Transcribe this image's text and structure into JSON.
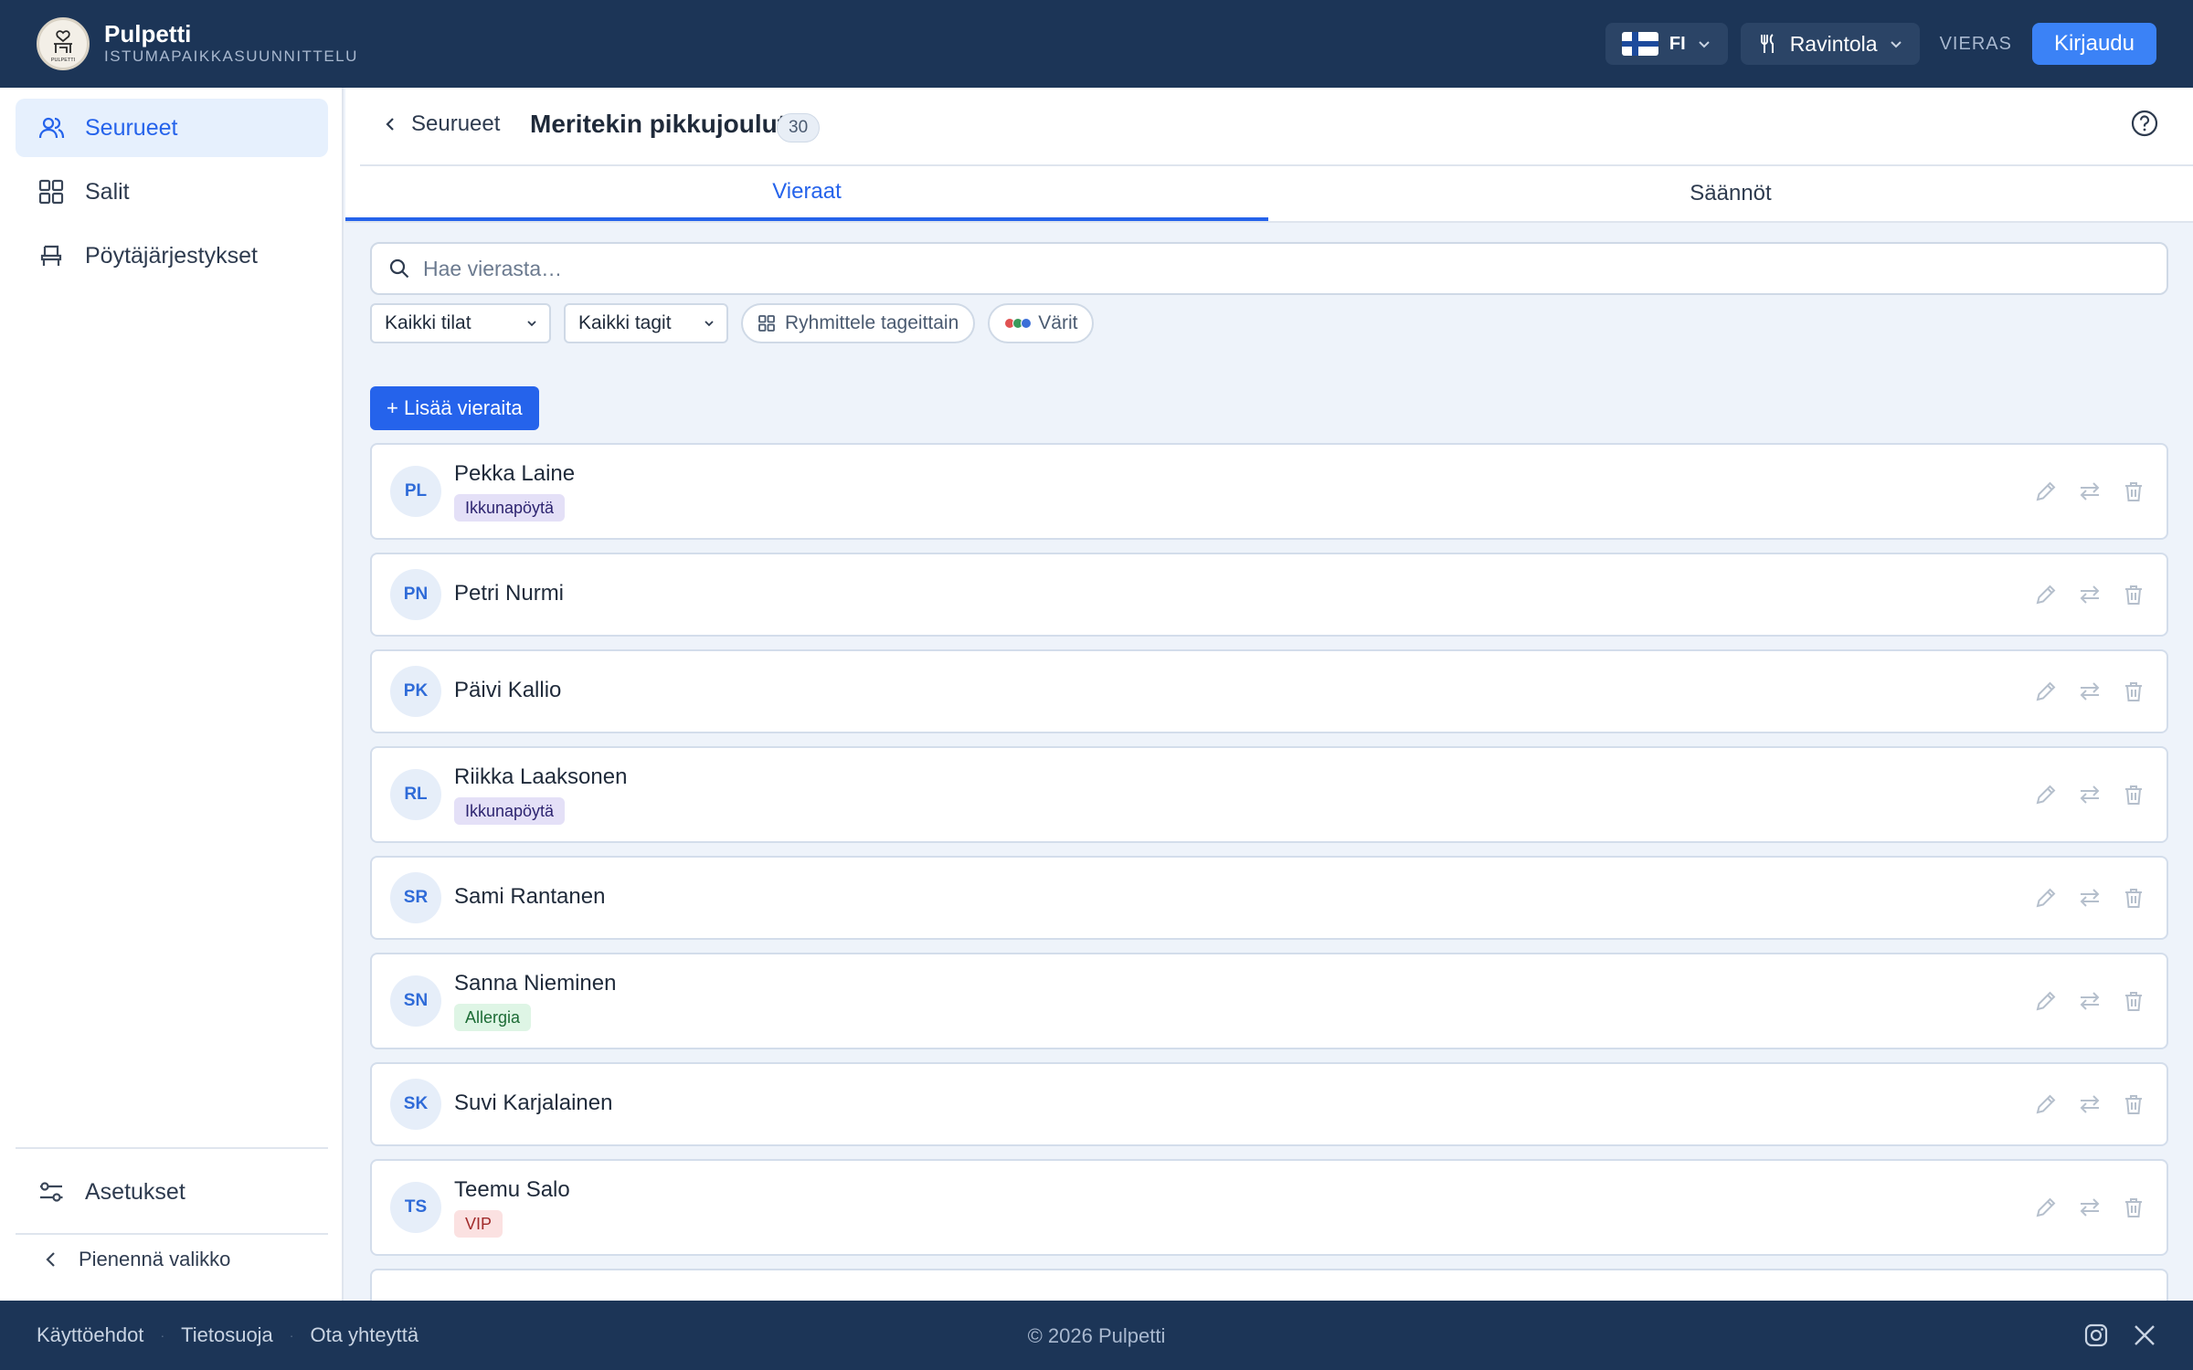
{
  "app": {
    "name": "Pulpetti",
    "subtitle": "ISTUMAPAIKKASUUNNITTELU",
    "logo_text": "PULPETTI"
  },
  "topbar": {
    "language": "FI",
    "venue_type": "Ravintola",
    "guest_label": "VIERAS",
    "login_label": "Kirjaudu"
  },
  "sidebar": {
    "items": [
      {
        "label": "Seurueet",
        "icon": "users-icon",
        "active": true
      },
      {
        "label": "Salit",
        "icon": "grid-icon",
        "active": false
      },
      {
        "label": "Pöytäjärjestykset",
        "icon": "chair-icon",
        "active": false
      }
    ],
    "settings_label": "Asetukset",
    "collapse_label": "Pienennä valikko"
  },
  "header": {
    "back_label": "Seurueet",
    "title": "Meritekin pikkujoulut",
    "count": "30"
  },
  "tabs": [
    {
      "label": "Vieraat",
      "active": true
    },
    {
      "label": "Säännöt",
      "active": false
    }
  ],
  "search": {
    "placeholder": "Hae vierasta…",
    "value": ""
  },
  "filters": {
    "status_select": "Kaikki tilat",
    "tag_select": "Kaikki tagit",
    "group_by_tags": "Ryhmittele tageittain",
    "colors": "Värit",
    "color_dots": [
      "#e05252",
      "#3a9a5b",
      "#3b6fd8"
    ]
  },
  "add_guests_label": "+ Lisää vieraita",
  "guests": [
    {
      "initials": "PL",
      "name": "Pekka Laine",
      "tag": "Ikkunapöytä",
      "tag_type": "purple"
    },
    {
      "initials": "PN",
      "name": "Petri Nurmi",
      "tag": "",
      "tag_type": ""
    },
    {
      "initials": "PK",
      "name": "Päivi Kallio",
      "tag": "",
      "tag_type": ""
    },
    {
      "initials": "RL",
      "name": "Riikka Laaksonen",
      "tag": "Ikkunapöytä",
      "tag_type": "purple"
    },
    {
      "initials": "SR",
      "name": "Sami Rantanen",
      "tag": "",
      "tag_type": ""
    },
    {
      "initials": "SN",
      "name": "Sanna Nieminen",
      "tag": "Allergia",
      "tag_type": "green"
    },
    {
      "initials": "SK",
      "name": "Suvi Karjalainen",
      "tag": "",
      "tag_type": ""
    },
    {
      "initials": "TS",
      "name": "Teemu Salo",
      "tag": "VIP",
      "tag_type": "red"
    }
  ],
  "footer": {
    "links": [
      "Käyttöehdot",
      "Tietosuoja",
      "Ota yhteyttä"
    ],
    "copyright": "© 2026 Pulpetti",
    "social": [
      "instagram-icon",
      "x-icon"
    ]
  },
  "colors": {
    "navy": "#1c3557",
    "accent": "#2563eb",
    "login_button": "#3b82f6",
    "tag_purple_bg": "#e4e0f7",
    "tag_green_bg": "#def5e5",
    "tag_red_bg": "#fbe1e1"
  }
}
